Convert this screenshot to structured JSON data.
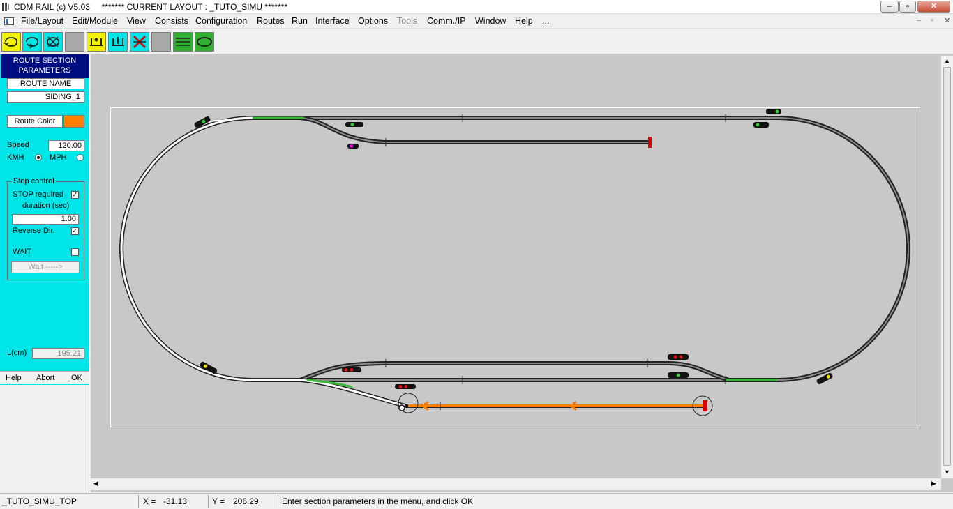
{
  "window": {
    "title": "CDM RAIL (c) V5.03     ******* CURRENT LAYOUT : _TUTO_SIMU *******",
    "minimize": "–",
    "maximize": "▫",
    "close": "✕"
  },
  "menu": {
    "items": [
      "File/Layout",
      "Edit/Module",
      "View",
      "Consists",
      "Configuration",
      "Routes",
      "Run",
      "Interface",
      "Options",
      "Tools",
      "Comm./IP",
      "Window",
      "Help",
      "..."
    ],
    "disabled": [
      "Tools"
    ]
  },
  "toolbar": {
    "buttons": [
      "loop-yellow-icon",
      "loop-cyan-icon",
      "loop-cross-icon",
      "gray-blank-icon",
      "signal-up-icon",
      "signal-split-icon",
      "cross-red-icon",
      "gray-blank-icon",
      "tracks-green-icon",
      "oval-green-icon"
    ]
  },
  "panel": {
    "header": "ROUTE SECTION PARAMETERS",
    "route_name_label": "ROUTE NAME",
    "route_name": "SIDING_1",
    "route_color_label": "Route Color",
    "route_color": "#ff8000",
    "speed_label": "Speed",
    "speed_value": "120.00",
    "kmh_label": "KMH",
    "mph_label": "MPH",
    "stop_group_label": "Stop control",
    "stop_required_label": "STOP required",
    "duration_label": "duration (sec)",
    "duration_value": "1.00",
    "reverse_label": "Reverse Dir.",
    "wait_label": "WAIT",
    "wait_button": "Wait ----->",
    "length_label": "L(cm)",
    "length_value": "195.21",
    "help": "Help",
    "abort": "Abort",
    "ok": "OK"
  },
  "status": {
    "layout": "_TUTO_SIMU_TOP",
    "x_label": "X =",
    "x_value": "-31.13",
    "y_label": "Y =",
    "y_value": "206.29",
    "message": "Enter section parameters in the menu, and click OK"
  },
  "colors": {
    "panel": "#00e5e8",
    "header": "#000d80",
    "route": "#ff8000",
    "active": "#38b838",
    "canvas": "#c8c8c8"
  }
}
